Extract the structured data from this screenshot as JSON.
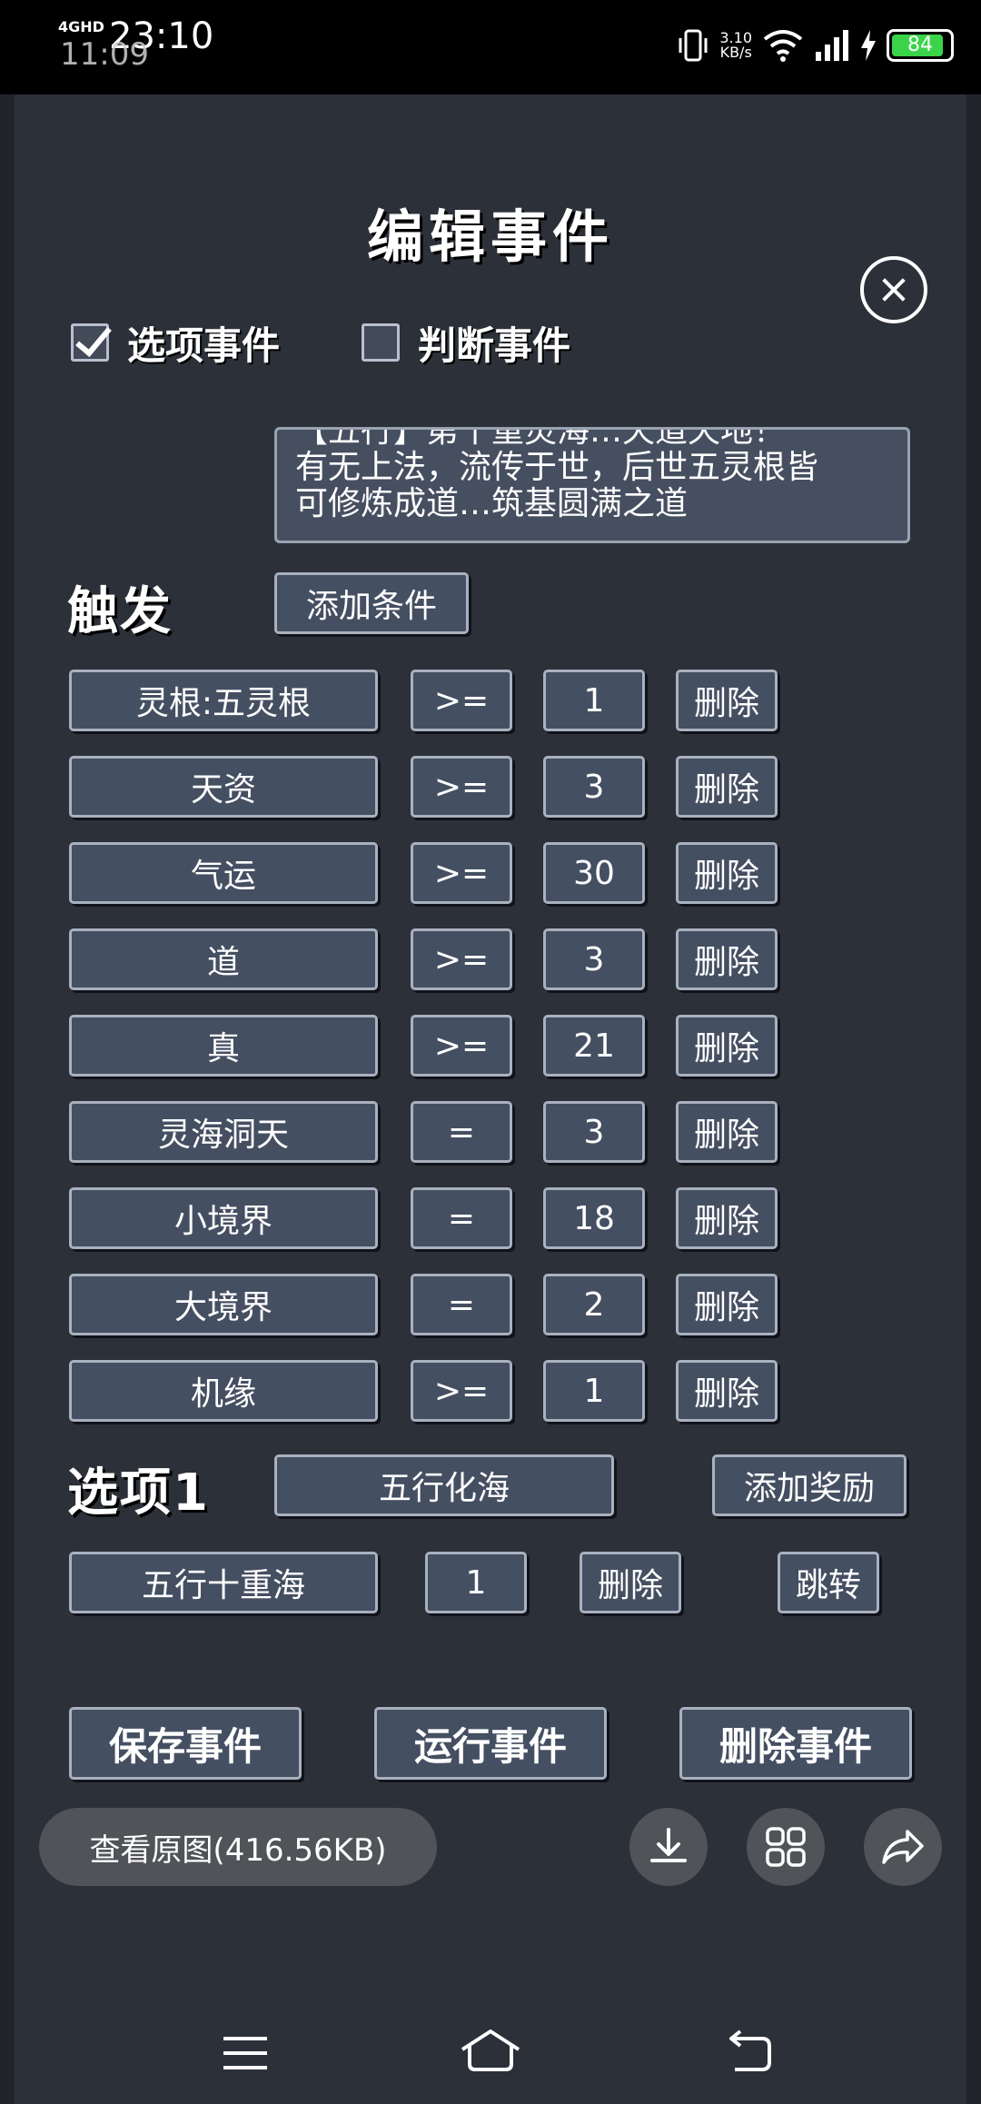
{
  "status_bar": {
    "network": "4GHD",
    "time": "23:10",
    "ghost_time": "11:09",
    "speed_value": "3.10",
    "speed_unit": "KB/s",
    "battery": "84",
    "colors": {
      "battery_fill": "#3bd34a"
    }
  },
  "dialog": {
    "title": "编辑事件",
    "close_icon": "close-icon",
    "checkboxes": [
      {
        "label": "选项事件",
        "checked": true
      },
      {
        "label": "判断事件",
        "checked": false
      }
    ],
    "description_lines": [
      "【五行】第十重灵海…天道天地！",
      "有无上法，流传于世，后世五灵根皆",
      "可修炼成道…筑基圆满之道"
    ],
    "trigger": {
      "heading": "触发",
      "add_condition": "添加条件",
      "conditions": [
        {
          "attr": "灵根:五灵根",
          "op": ">=",
          "value": "1",
          "delete": "删除"
        },
        {
          "attr": "天资",
          "op": ">=",
          "value": "3",
          "delete": "删除"
        },
        {
          "attr": "气运",
          "op": ">=",
          "value": "30",
          "delete": "删除"
        },
        {
          "attr": "道",
          "op": ">=",
          "value": "3",
          "delete": "删除"
        },
        {
          "attr": "真",
          "op": ">=",
          "value": "21",
          "delete": "删除"
        },
        {
          "attr": "灵海洞天",
          "op": "=",
          "value": "3",
          "delete": "删除"
        },
        {
          "attr": "小境界",
          "op": "=",
          "value": "18",
          "delete": "删除"
        },
        {
          "attr": "大境界",
          "op": "=",
          "value": "2",
          "delete": "删除"
        },
        {
          "attr": "机缘",
          "op": ">=",
          "value": "1",
          "delete": "删除"
        }
      ]
    },
    "option": {
      "heading": "选项1",
      "name": "五行化海",
      "add_reward": "添加奖励",
      "reward": {
        "name": "五行十重海",
        "value": "1",
        "delete": "删除",
        "jump": "跳转"
      }
    },
    "actions": {
      "save": "保存事件",
      "run": "运行事件",
      "delete": "删除事件"
    }
  },
  "viewer_bar": {
    "view_original": "查看原图(416.56KB)",
    "icons": [
      "download-icon",
      "grid-icon",
      "share-icon"
    ]
  },
  "nav_bar": {
    "icons": [
      "menu-icon",
      "home-icon",
      "back-icon"
    ]
  }
}
